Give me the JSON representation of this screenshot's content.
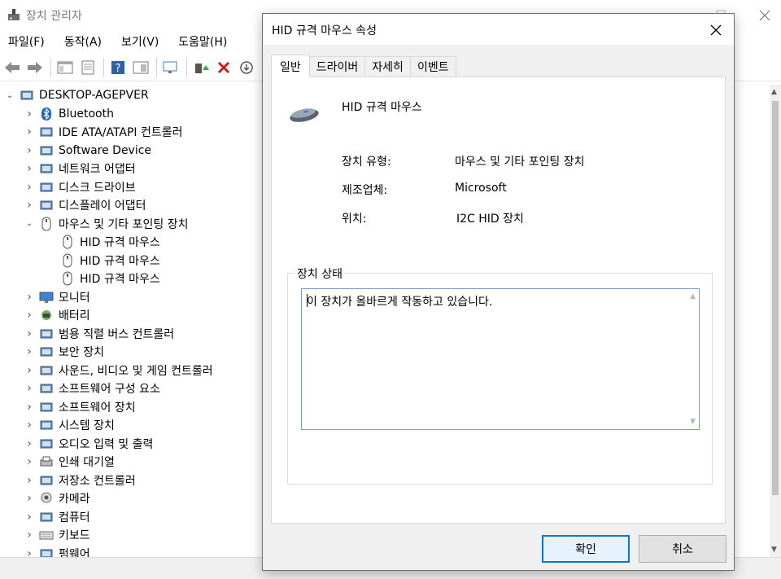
{
  "main": {
    "title": "장치 관리자",
    "menu": [
      "파일(F)",
      "동작(A)",
      "보기(V)",
      "도움말(H)"
    ],
    "tree": {
      "root": "DESKTOP-AGEPVER",
      "items": [
        {
          "label": "Bluetooth",
          "icon": "bluetooth-icon",
          "expanded": false
        },
        {
          "label": "IDE ATA/ATAPI 컨트롤러",
          "icon": "ide-controller-icon",
          "expanded": false
        },
        {
          "label": "Software Device",
          "icon": "software-device-icon",
          "expanded": false
        },
        {
          "label": "네트워크 어댑터",
          "icon": "network-adapter-icon",
          "expanded": false
        },
        {
          "label": "디스크 드라이브",
          "icon": "disk-drive-icon",
          "expanded": false
        },
        {
          "label": "디스플레이 어댑터",
          "icon": "display-adapter-icon",
          "expanded": false
        },
        {
          "label": "마우스 및 기타 포인팅 장치",
          "icon": "mouse-icon",
          "expanded": true,
          "children": [
            "HID 규격 마우스",
            "HID 규격 마우스",
            "HID 규격 마우스"
          ]
        },
        {
          "label": "모니터",
          "icon": "monitor-icon",
          "expanded": false
        },
        {
          "label": "배터리",
          "icon": "battery-icon",
          "expanded": false
        },
        {
          "label": "범용 직렬 버스 컨트롤러",
          "icon": "usb-icon",
          "expanded": false
        },
        {
          "label": "보안 장치",
          "icon": "security-device-icon",
          "expanded": false
        },
        {
          "label": "사운드, 비디오 및 게임 컨트롤러",
          "icon": "sound-icon",
          "expanded": false
        },
        {
          "label": "소프트웨어 구성 요소",
          "icon": "software-component-icon",
          "expanded": false
        },
        {
          "label": "소프트웨어 장치",
          "icon": "software-device2-icon",
          "expanded": false
        },
        {
          "label": "시스템 장치",
          "icon": "system-device-icon",
          "expanded": false
        },
        {
          "label": "오디오 입력 및 출력",
          "icon": "audio-icon",
          "expanded": false
        },
        {
          "label": "인쇄 대기열",
          "icon": "printer-icon",
          "expanded": false
        },
        {
          "label": "저장소 컨트롤러",
          "icon": "storage-controller-icon",
          "expanded": false
        },
        {
          "label": "카메라",
          "icon": "camera-icon",
          "expanded": false
        },
        {
          "label": "컴퓨터",
          "icon": "computer-icon",
          "expanded": false
        },
        {
          "label": "키보드",
          "icon": "keyboard-icon",
          "expanded": false
        },
        {
          "label": "펌웨어",
          "icon": "firmware-icon",
          "expanded": false
        }
      ]
    }
  },
  "dialog": {
    "title": "HID 규격 마우스 속성",
    "tabs": [
      "일반",
      "드라이버",
      "자세히",
      "이벤트"
    ],
    "device_name": "HID 규격 마우스",
    "properties": [
      {
        "label": "장치 유형:",
        "value": "마우스 및 기타 포인팅 장치"
      },
      {
        "label": "제조업체:",
        "value": "Microsoft"
      },
      {
        "label": "위치:",
        "value": "I2C HID 장치"
      }
    ],
    "status_group": "장치 상태",
    "status_text": "이 장치가 올바르게 작동하고 있습니다.",
    "ok_label": "확인",
    "cancel_label": "취소"
  },
  "colors": {
    "accent": "#0078d7",
    "dialog_bg": "#f0f0f0",
    "panel_bg": "#ffffff"
  }
}
